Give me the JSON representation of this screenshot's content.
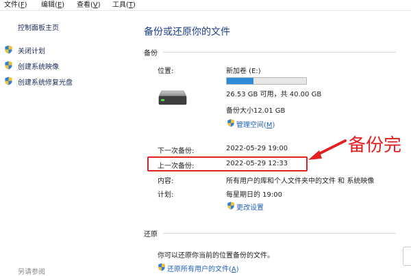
{
  "menubar": {
    "file": "文件(",
    "file_key": "F",
    "file_end": ")",
    "edit": "编辑(",
    "edit_key": "E",
    "edit_end": ")",
    "view": "查看(",
    "view_key": "V",
    "view_end": ")",
    "tools": "工具(",
    "tools_key": "T",
    "tools_end": ")"
  },
  "sidebar": {
    "home": "控制面板主页",
    "items": [
      {
        "label": "关闭计划"
      },
      {
        "label": "创建系统映像"
      },
      {
        "label": "创建系统修复光盘"
      }
    ],
    "bottom": "另请参阅"
  },
  "main": {
    "title": "备份或还原你的文件",
    "backup": {
      "section": "备份",
      "location_label": "位置:",
      "location_value": "新加卷 (E:)",
      "usage_fraction": 0.34,
      "space_text": "26.53 GB 可用，共 40.00 GB",
      "backup_size": "备份大小12.01 GB",
      "manage_space_prefix": "管理空间(",
      "manage_space_key": "M",
      "manage_space_end": ")",
      "next_backup_label": "下一次备份:",
      "next_backup_value": "2022-05-29 19:00",
      "last_backup_label": "上一次备份:",
      "last_backup_value": "2022-05-29 12:33",
      "content_label": "内容:",
      "content_value": "所有用户的库和个人文件夹中的文件 和 系统映像",
      "schedule_label": "计划:",
      "schedule_value": "每星期日的 19:00",
      "change_settings": "更改设置"
    },
    "restore": {
      "section": "还原",
      "description": "你可以还原你当前的位置备份的文件。",
      "restore_all_prefix": "还原所有用户的文件(",
      "restore_all_key": "A",
      "restore_all_end": ")"
    }
  },
  "annotation": {
    "text": "备份完",
    "color": "#e22020"
  },
  "colors": {
    "link": "#1f5fbf",
    "title": "#1c3f8f",
    "progress": "#2d8ad8"
  }
}
